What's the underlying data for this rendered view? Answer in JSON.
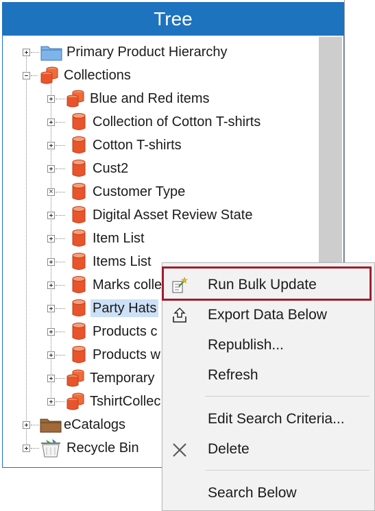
{
  "panel": {
    "title": "Tree"
  },
  "tree": {
    "primary_hierarchy": "Primary Product Hierarchy",
    "collections": "Collections",
    "children": [
      {
        "label": "Blue and Red items",
        "icon": "collection-group-icon"
      },
      {
        "label": "Collection of Cotton T-shirts",
        "icon": "collection-icon"
      },
      {
        "label": "Cotton T-shirts",
        "icon": "collection-icon"
      },
      {
        "label": "Cust2",
        "icon": "collection-icon"
      },
      {
        "label": "Customer Type",
        "icon": "collection-icon"
      },
      {
        "label": "Digital Asset Review State",
        "icon": "collection-icon"
      },
      {
        "label": "Item List",
        "icon": "collection-icon"
      },
      {
        "label": "Items List",
        "icon": "collection-icon"
      },
      {
        "label": "Marks colle",
        "icon": "collection-icon"
      },
      {
        "label": "Party Hats",
        "icon": "collection-icon"
      },
      {
        "label": "Products c",
        "icon": "collection-icon"
      },
      {
        "label": "Products w",
        "icon": "collection-icon"
      },
      {
        "label": "Temporary",
        "icon": "collection-group-icon"
      },
      {
        "label": "TshirtCollec",
        "icon": "collection-group-icon"
      }
    ],
    "ecatalogs": "eCatalogs",
    "recycle_bin": "Recycle Bin"
  },
  "context_menu": {
    "items": [
      {
        "label": "Run Bulk Update",
        "icon": "bulk-update-icon"
      },
      {
        "label": "Export Data Below",
        "icon": "export-icon"
      },
      {
        "label": "Republish...",
        "icon": ""
      },
      {
        "label": "Refresh",
        "icon": ""
      },
      {
        "label": "Edit Search Criteria...",
        "icon": ""
      },
      {
        "label": "Delete",
        "icon": "delete-icon"
      },
      {
        "label": "Search Below",
        "icon": ""
      }
    ]
  },
  "colors": {
    "header": "#1e73be",
    "highlight_border": "#a01d2c",
    "selection": "#cce0f7",
    "collection_icon": "#e8542b"
  }
}
